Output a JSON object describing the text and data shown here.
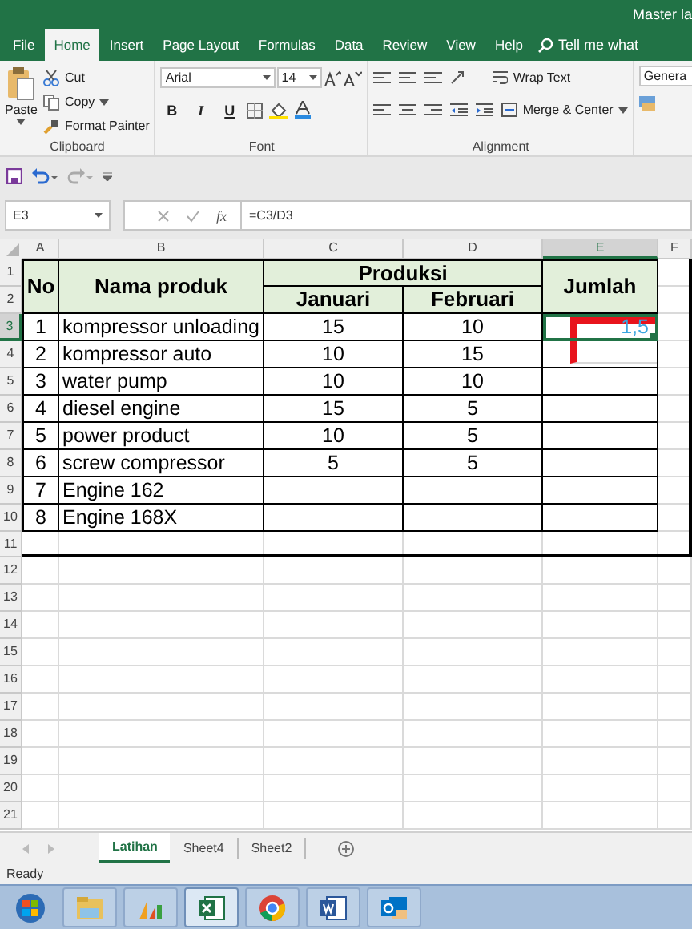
{
  "window": {
    "title": "Master la"
  },
  "tabs": [
    {
      "label": "File",
      "selected": false
    },
    {
      "label": "Home",
      "selected": true
    },
    {
      "label": "Insert",
      "selected": false
    },
    {
      "label": "Page Layout",
      "selected": false
    },
    {
      "label": "Formulas",
      "selected": false
    },
    {
      "label": "Data",
      "selected": false
    },
    {
      "label": "Review",
      "selected": false
    },
    {
      "label": "View",
      "selected": false
    },
    {
      "label": "Help",
      "selected": false
    }
  ],
  "tell_me": "Tell me what",
  "ribbon": {
    "clipboard": {
      "paste": "Paste",
      "cut": "Cut",
      "copy": "Copy",
      "format_painter": "Format Painter",
      "label": "Clipboard"
    },
    "font": {
      "name": "Arial",
      "size": "14",
      "bold": "B",
      "italic": "I",
      "underline": "U",
      "label": "Font"
    },
    "alignment": {
      "wrap_text": "Wrap Text",
      "merge_center": "Merge & Center",
      "label": "Alignment"
    },
    "number": {
      "format": "Genera"
    }
  },
  "formula_bar": {
    "name_box": "E3",
    "fx": "fx",
    "formula": "=C3/D3"
  },
  "sheet": {
    "columns": [
      {
        "label": "A",
        "selected": false
      },
      {
        "label": "B",
        "selected": false
      },
      {
        "label": "C",
        "selected": false
      },
      {
        "label": "D",
        "selected": false
      },
      {
        "label": "E",
        "selected": true
      },
      {
        "label": "F",
        "selected": false
      }
    ],
    "row_numbers": [
      {
        "label": "1",
        "selected": false
      },
      {
        "label": "2",
        "selected": false
      },
      {
        "label": "3",
        "selected": true
      },
      {
        "label": "4",
        "selected": false
      },
      {
        "label": "5",
        "selected": false
      },
      {
        "label": "6",
        "selected": false
      },
      {
        "label": "7",
        "selected": false
      },
      {
        "label": "8",
        "selected": false
      },
      {
        "label": "9",
        "selected": false
      },
      {
        "label": "10",
        "selected": false
      },
      {
        "label": "11",
        "selected": false
      },
      {
        "label": "12",
        "selected": false
      },
      {
        "label": "13",
        "selected": false
      },
      {
        "label": "14",
        "selected": false
      },
      {
        "label": "15",
        "selected": false
      },
      {
        "label": "16",
        "selected": false
      },
      {
        "label": "17",
        "selected": false
      },
      {
        "label": "18",
        "selected": false
      },
      {
        "label": "19",
        "selected": false
      },
      {
        "label": "20",
        "selected": false
      },
      {
        "label": "21",
        "selected": false
      }
    ],
    "header": {
      "no": "No",
      "name": "Nama produk",
      "group": "Produksi",
      "jan": "Januari",
      "feb": "Februari",
      "total": "Jumlah"
    },
    "rows": [
      {
        "no": "1",
        "name": "kompressor unloading",
        "jan": "15",
        "feb": "10",
        "total": "1,5",
        "selected": true
      },
      {
        "no": "2",
        "name": "kompressor auto",
        "jan": "10",
        "feb": "15",
        "selected": false
      },
      {
        "no": "3",
        "name": "water pump",
        "jan": "10",
        "feb": "10",
        "selected": false
      },
      {
        "no": "4",
        "name": "diesel engine",
        "jan": "15",
        "feb": "5",
        "selected": false
      },
      {
        "no": "5",
        "name": "power product",
        "jan": "10",
        "feb": "5",
        "selected": false
      },
      {
        "no": "6",
        "name": "screw compressor",
        "jan": "5",
        "feb": "5",
        "selected": false
      },
      {
        "no": "7",
        "name": "Engine 162",
        "selected": false
      },
      {
        "no": "8",
        "name": "Engine 168X",
        "selected": false
      }
    ],
    "annotation_box": true
  },
  "sheet_tabs": [
    {
      "label": "Latihan",
      "selected": true
    },
    {
      "label": "Sheet4",
      "selected": false
    },
    {
      "label": "Sheet2",
      "selected": false
    }
  ],
  "status": "Ready",
  "taskbar": [
    {
      "kind": "start"
    },
    {
      "kind": "folder",
      "active": false
    },
    {
      "kind": "analytics",
      "active": false
    },
    {
      "kind": "excel",
      "active": true
    },
    {
      "kind": "chrome",
      "active": false
    },
    {
      "kind": "word",
      "active": false
    },
    {
      "kind": "outlook",
      "active": false
    }
  ]
}
